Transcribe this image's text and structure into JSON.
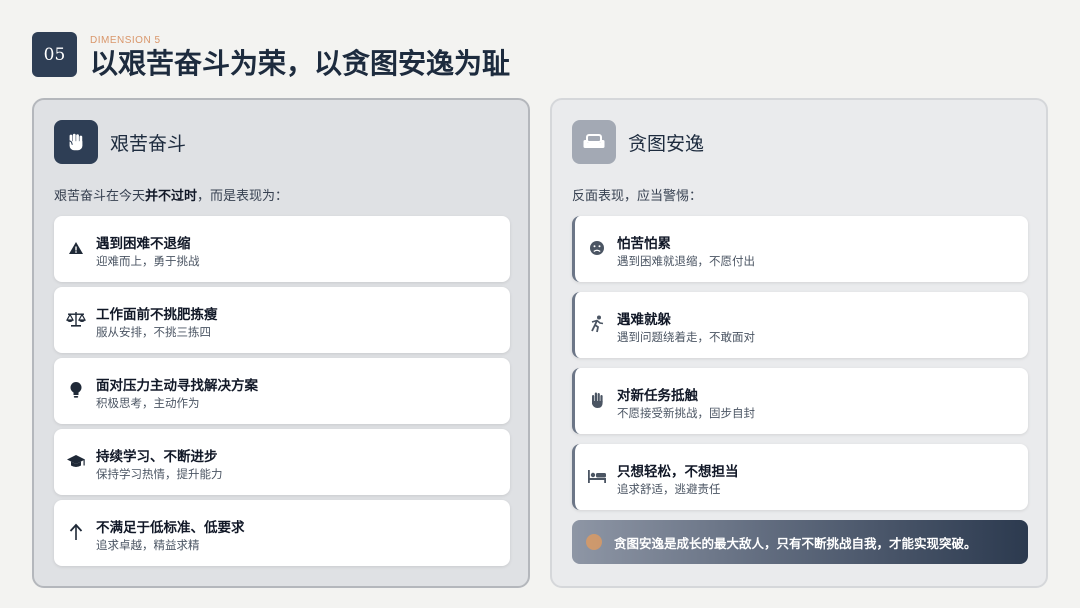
{
  "header": {
    "number": "05",
    "dimension_label": "DIMENSION 5",
    "title": "以艰苦奋斗为荣，以贪图安逸为耻"
  },
  "left_panel": {
    "title": "艰苦奋斗",
    "icon": "fist-icon",
    "intro_prefix": "艰苦奋斗在今天",
    "intro_bold": "并不过时",
    "intro_suffix": "，而是表现为：",
    "items": [
      {
        "icon": "warning-triangle-icon",
        "title": "遇到困难不退缩",
        "subtitle": "迎难而上，勇于挑战"
      },
      {
        "icon": "balance-scale-icon",
        "title": "工作面前不挑肥拣瘦",
        "subtitle": "服从安排，不挑三拣四"
      },
      {
        "icon": "lightbulb-icon",
        "title": "面对压力主动寻找解决方案",
        "subtitle": "积极思考，主动作为"
      },
      {
        "icon": "graduation-cap-icon",
        "title": "持续学习、不断进步",
        "subtitle": "保持学习热情，提升能力"
      },
      {
        "icon": "arrow-up-icon",
        "title": "不满足于低标准、低要求",
        "subtitle": "追求卓越，精益求精"
      }
    ]
  },
  "right_panel": {
    "title": "贪图安逸",
    "icon": "sofa-icon",
    "intro": "反面表现，应当警惕：",
    "items": [
      {
        "icon": "sad-face-icon",
        "title": "怕苦怕累",
        "subtitle": "遇到困难就退缩，不愿付出"
      },
      {
        "icon": "running-person-icon",
        "title": "遇难就躲",
        "subtitle": "遇到问题绕着走，不敢面对"
      },
      {
        "icon": "raised-hand-icon",
        "title": "对新任务抵触",
        "subtitle": "不愿接受新挑战，固步自封"
      },
      {
        "icon": "bed-icon",
        "title": "只想轻松，不想担当",
        "subtitle": "追求舒适，逃避责任"
      }
    ],
    "banner": "贪图安逸是成长的最大敌人，只有不断挑战自我，才能实现突破。"
  },
  "colors": {
    "navy": "#2e3e55",
    "accent_orange": "#d9966a",
    "muted_icon": "#a3a9b4"
  }
}
